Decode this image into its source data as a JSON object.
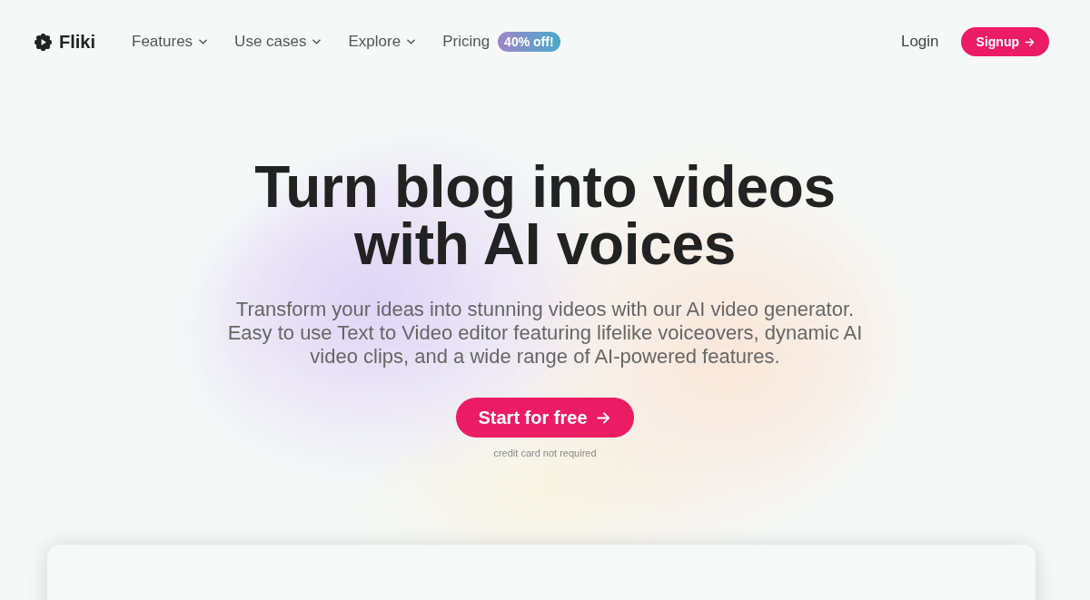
{
  "brand": {
    "name": "Fliki"
  },
  "nav": {
    "items": [
      {
        "label": "Features",
        "dropdown": true
      },
      {
        "label": "Use cases",
        "dropdown": true
      },
      {
        "label": "Explore",
        "dropdown": true
      },
      {
        "label": "Pricing",
        "dropdown": false,
        "badge": "40% off!"
      }
    ]
  },
  "auth": {
    "login": "Login",
    "signup": "Signup"
  },
  "hero": {
    "title_lines": [
      "Turn blog into videos",
      "with AI voices"
    ],
    "subtitle": "Transform your ideas into stunning videos with our AI video generator. Easy to use Text to Video editor featuring lifelike voiceovers, dynamic AI video clips, and a wide range of AI-powered features.",
    "cta": "Start for free",
    "note": "credit card not required"
  }
}
